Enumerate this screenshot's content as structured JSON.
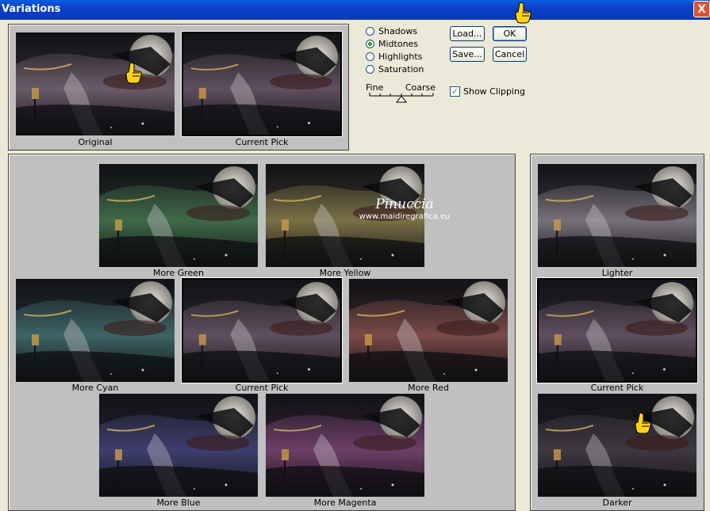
{
  "window": {
    "title": "Variations",
    "close_glyph": "X"
  },
  "top_thumbs": {
    "original_label": "Original",
    "current_label": "Current Pick"
  },
  "options": {
    "radios": [
      {
        "label": "Shadows",
        "selected": false
      },
      {
        "label": "Midtones",
        "selected": true
      },
      {
        "label": "Highlights",
        "selected": false
      },
      {
        "label": "Saturation",
        "selected": false
      }
    ],
    "fine_label": "Fine",
    "coarse_label": "Coarse",
    "show_clipping_label": "Show Clipping",
    "show_clipping_checked": true
  },
  "buttons": {
    "load": "Load...",
    "save": "Save...",
    "ok": "OK",
    "cancel": "Cancel"
  },
  "color_grid": {
    "more_green": "More Green",
    "more_yellow": "More Yellow",
    "more_cyan": "More Cyan",
    "current_pick": "Current Pick",
    "more_red": "More Red",
    "more_blue": "More Blue",
    "more_magenta": "More Magenta"
  },
  "brightness": {
    "lighter": "Lighter",
    "current_pick": "Current Pick",
    "darker": "Darker"
  },
  "watermark": {
    "name": "Pinuccia",
    "url": "www.maidiregrafica.eu"
  },
  "tints": {
    "original": "#6a5a68",
    "current": "#5f4f5e",
    "green": "#3f6a48",
    "yellow": "#7a7046",
    "cyan": "#3d6466",
    "red": "#7a4a48",
    "blue": "#3d3e6e",
    "magenta": "#6e3f68",
    "lighter": "#767078",
    "darker": "#3e3840"
  }
}
